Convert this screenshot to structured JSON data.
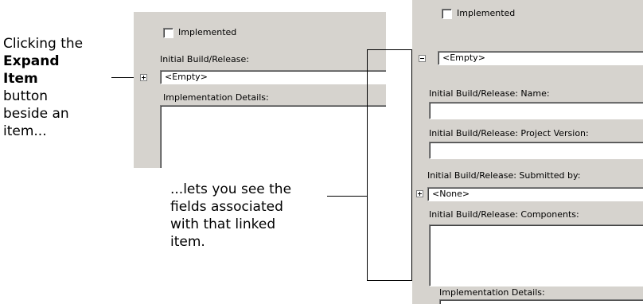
{
  "callout_left": {
    "line1": "Clicking the",
    "bold1": "Expand",
    "bold2": "Item",
    "line3": "button",
    "line4": "beside an",
    "line5": "item..."
  },
  "callout_right": {
    "line1": "...lets you see the",
    "line2": "fields associated",
    "line3": "with that linked",
    "line4": "item."
  },
  "left_panel": {
    "implemented_label": "Implemented",
    "build_label": "Initial Build/Release:",
    "build_value": "<Empty>",
    "details_label": "Implementation Details:"
  },
  "right_panel": {
    "implemented_label": "Implemented",
    "build_value": "<Empty>",
    "name_label": "Initial Build/Release: Name:",
    "version_label": "Initial Build/Release: Project Version:",
    "submitted_label": "Initial Build/Release: Submitted by:",
    "submitted_value": "<None>",
    "components_label": "Initial Build/Release: Components:",
    "details_label": "Implementation Details:"
  },
  "icons": {
    "expand": "plus-box",
    "collapse": "minus-box"
  }
}
